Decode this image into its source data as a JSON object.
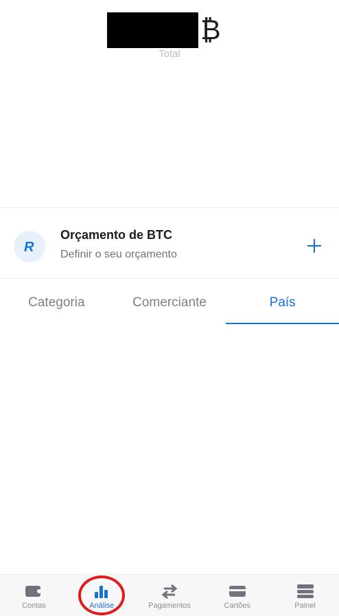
{
  "header": {
    "currency_symbol": "₿",
    "total_label": "Total"
  },
  "budget": {
    "title": "Orçamento de BTC",
    "subtitle": "Definir o seu orçamento",
    "avatar_letter": "R"
  },
  "tabs": [
    {
      "label": "Categoria",
      "active": false
    },
    {
      "label": "Comerciante",
      "active": false
    },
    {
      "label": "País",
      "active": true
    }
  ],
  "bottom_nav": [
    {
      "label": "Contas",
      "icon": "wallet-icon"
    },
    {
      "label": "Análise",
      "icon": "bar-chart-icon",
      "active": true
    },
    {
      "label": "Pagamentos",
      "icon": "transfer-arrows-icon"
    },
    {
      "label": "Cartões",
      "icon": "card-icon"
    },
    {
      "label": "Painel",
      "icon": "menu-stack-icon"
    }
  ],
  "colors": {
    "accent": "#1672d6",
    "annotation": "#e01b1b"
  }
}
